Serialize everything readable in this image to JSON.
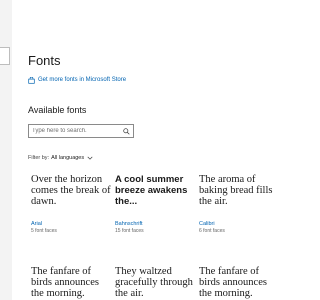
{
  "header": {
    "title": "Fonts",
    "store_link": "Get more fonts in Microsoft Store"
  },
  "available": {
    "heading": "Available fonts",
    "search_placeholder": "Type here to search.",
    "filter_label": "Filter by:",
    "filter_value": "All languages"
  },
  "fonts": [
    {
      "preview": "Over the horizon comes the break of dawn.",
      "name": "Arial",
      "faces": "5 font faces"
    },
    {
      "preview": "A cool summer breeze awakens the...",
      "name": "Bahnschrift",
      "faces": "15 font faces"
    },
    {
      "preview": "The aroma of baking bread fills the air.",
      "name": "Calibri",
      "faces": "6 font faces"
    },
    {
      "preview": "The fanfare of birds announces the morning.",
      "name": "",
      "faces": ""
    },
    {
      "preview": "They waltzed gracefully through the air.",
      "name": "",
      "faces": ""
    },
    {
      "preview": "The fanfare of birds announces the morning.",
      "name": "",
      "faces": ""
    }
  ],
  "colors": {
    "accent": "#0063b1",
    "text": "#1a1a1a",
    "sidebar": "#f3f3f3"
  }
}
